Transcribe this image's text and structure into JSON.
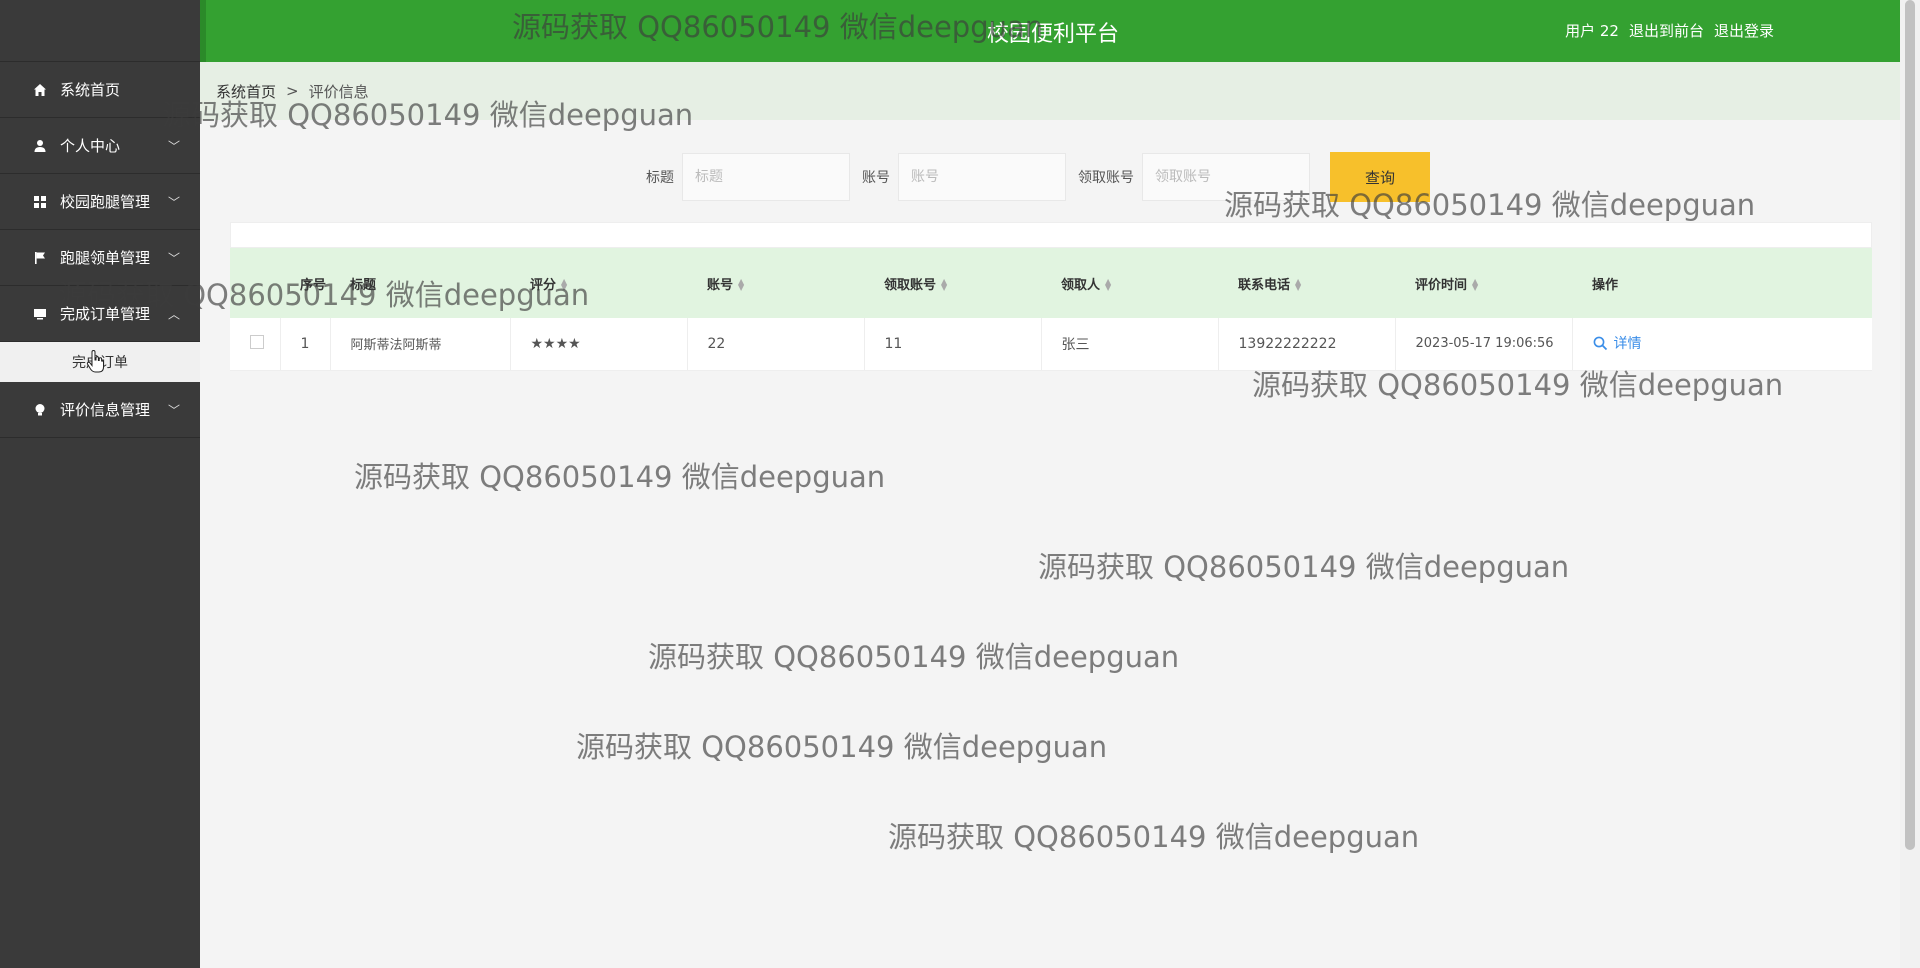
{
  "header": {
    "title": "校园便利平台",
    "user": "用户 22",
    "links": [
      "退出到前台",
      "退出登录"
    ]
  },
  "sidebar": {
    "items": [
      {
        "label": "系统首页",
        "icon": "home-icon",
        "has_chevron": false
      },
      {
        "label": "个人中心",
        "icon": "user-icon",
        "has_chevron": true
      },
      {
        "label": "校园跑腿管理",
        "icon": "grid-icon",
        "has_chevron": true
      },
      {
        "label": "跑腿领单管理",
        "icon": "flag-icon",
        "has_chevron": true
      },
      {
        "label": "完成订单管理",
        "icon": "monitor-icon",
        "has_chevron": true,
        "expanded": true
      },
      {
        "label": "评价信息管理",
        "icon": "bulb-icon",
        "has_chevron": true
      }
    ],
    "submenu": [
      "完成订单"
    ]
  },
  "breadcrumb": {
    "home": "系统首页",
    "separator": ">",
    "current": "评价信息"
  },
  "search": {
    "fields": [
      {
        "label": "标题",
        "placeholder": "标题"
      },
      {
        "label": "账号",
        "placeholder": "账号"
      },
      {
        "label": "领取账号",
        "placeholder": "领取账号"
      }
    ],
    "button": "查询"
  },
  "table": {
    "columns": [
      "序号",
      "标题",
      "评分",
      "账号",
      "领取账号",
      "领取人",
      "联系电话",
      "评价时间",
      "操作"
    ],
    "rows": [
      {
        "index": "1",
        "title": "阿斯蒂法阿斯蒂",
        "rating": "★★★★",
        "account": "22",
        "receiver_account": "11",
        "receiver": "张三",
        "phone": "13922222222",
        "time": "2023-05-17 19:06:56",
        "action": "详情"
      }
    ]
  },
  "watermark": "源码获取 QQ86050149 微信deepguan",
  "colors": {
    "header": "#34a131",
    "sidebar": "#3a3a3a",
    "table_header": "#e1f4e0",
    "query_button": "#f7c02b",
    "link": "#3b8ee8"
  }
}
